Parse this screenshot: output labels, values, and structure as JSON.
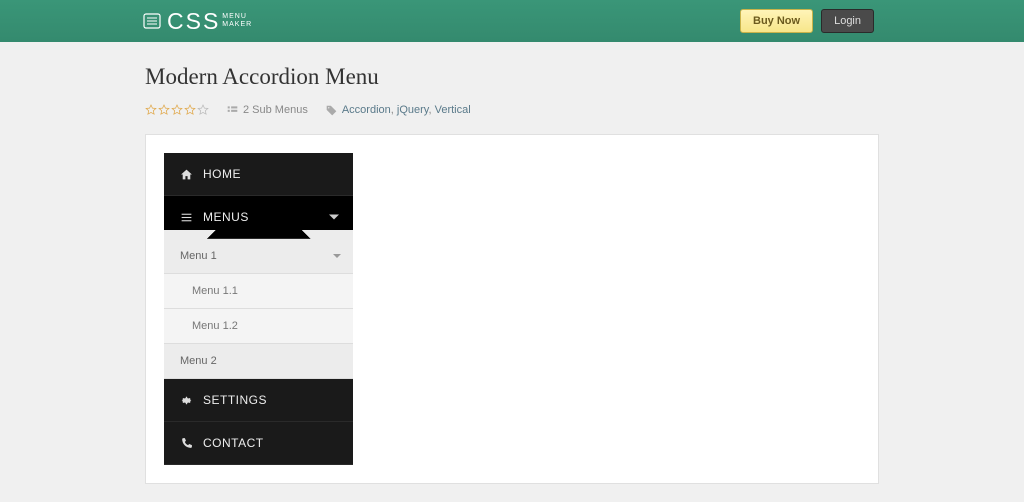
{
  "header": {
    "logo_css": "CSS",
    "logo_line1": "MENU",
    "logo_line2": "MAKER",
    "buy": "Buy Now",
    "login": "Login"
  },
  "title": "Modern Accordion Menu",
  "meta": {
    "submenus": "2 Sub Menus",
    "tags": [
      "Accordion",
      "jQuery",
      "Vertical"
    ]
  },
  "menu": {
    "home": "HOME",
    "menus": "MENUS",
    "menu1": "Menu 1",
    "menu1_1": "Menu 1.1",
    "menu1_2": "Menu 1.2",
    "menu2": "Menu 2",
    "settings": "SETTINGS",
    "contact": "CONTACT"
  }
}
